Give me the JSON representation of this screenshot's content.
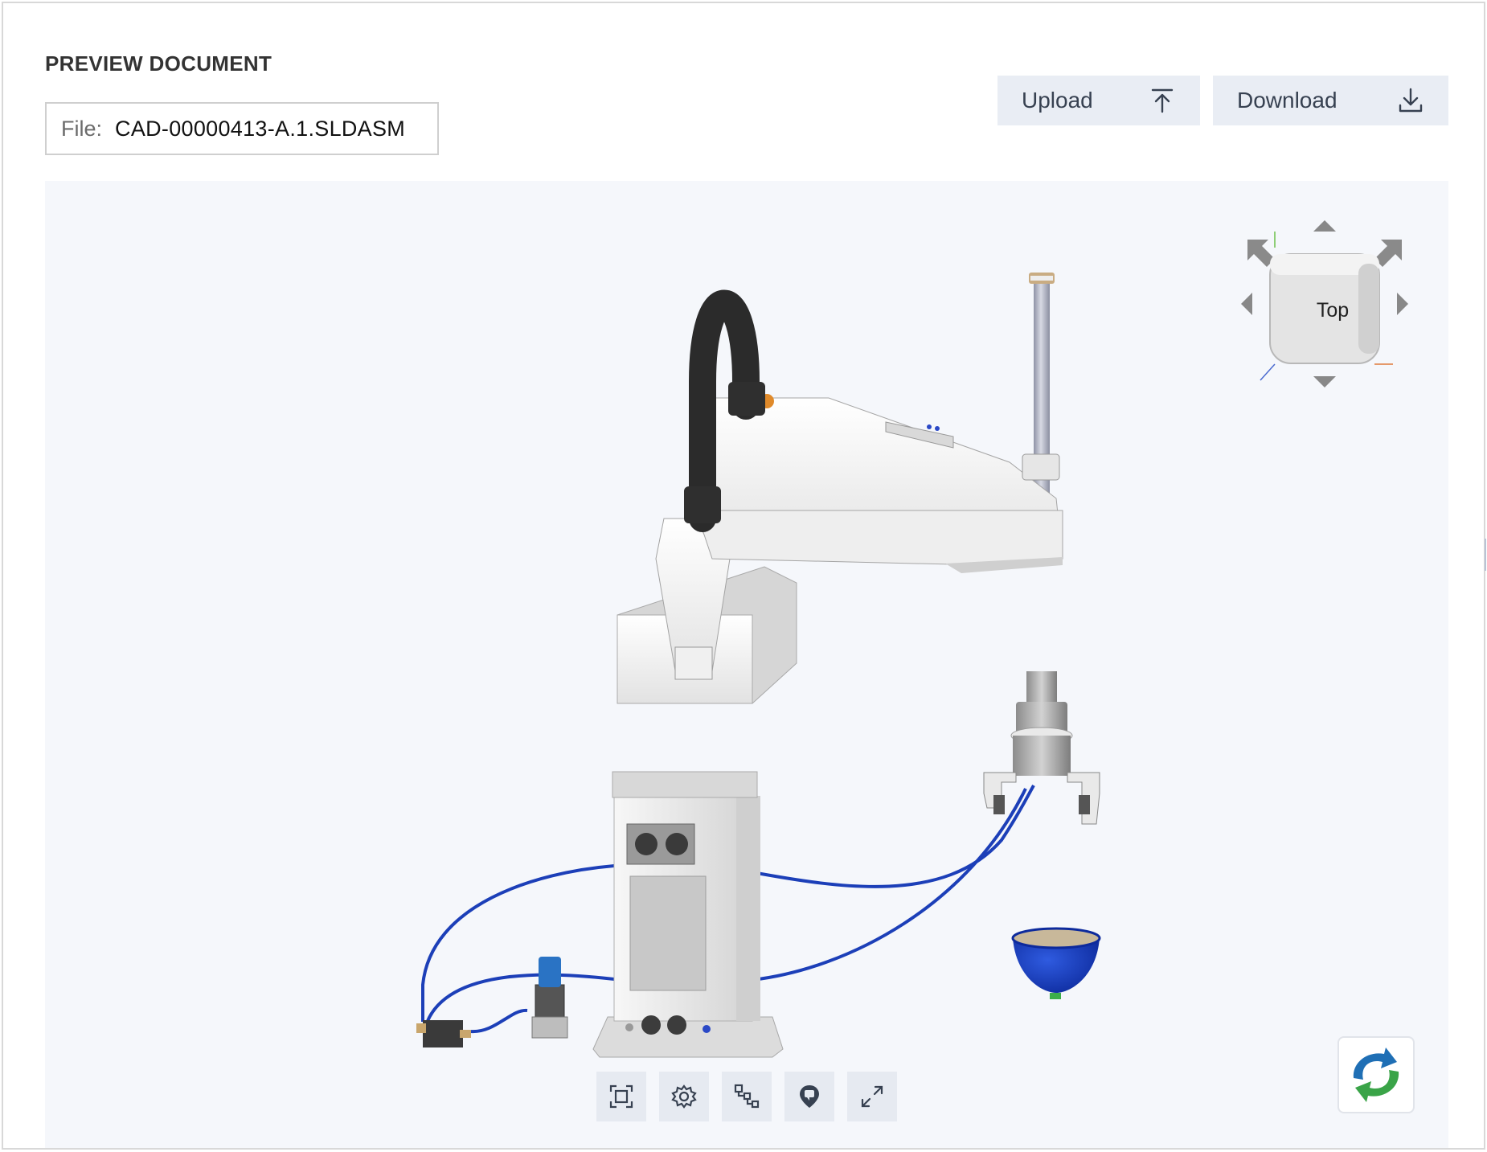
{
  "header": {
    "title": "PREVIEW DOCUMENT",
    "file_label": "File:",
    "file_name": "CAD-00000413-A.1.SLDASM"
  },
  "actions": {
    "upload_label": "Upload",
    "download_label": "Download"
  },
  "viewer": {
    "navcube_face": "Top",
    "toolbar_icons": [
      "fit-view-icon",
      "settings-gear-icon",
      "structure-tree-icon",
      "markup-pin-icon",
      "fullscreen-icon"
    ],
    "sync_icon": "sync-refresh-icon"
  },
  "colors": {
    "button_bg": "#e9edf4",
    "viewer_bg": "#f5f7fb",
    "hose_blue": "#1c3fb8",
    "sync_blue": "#1f6fb5",
    "sync_green": "#3aa448"
  }
}
